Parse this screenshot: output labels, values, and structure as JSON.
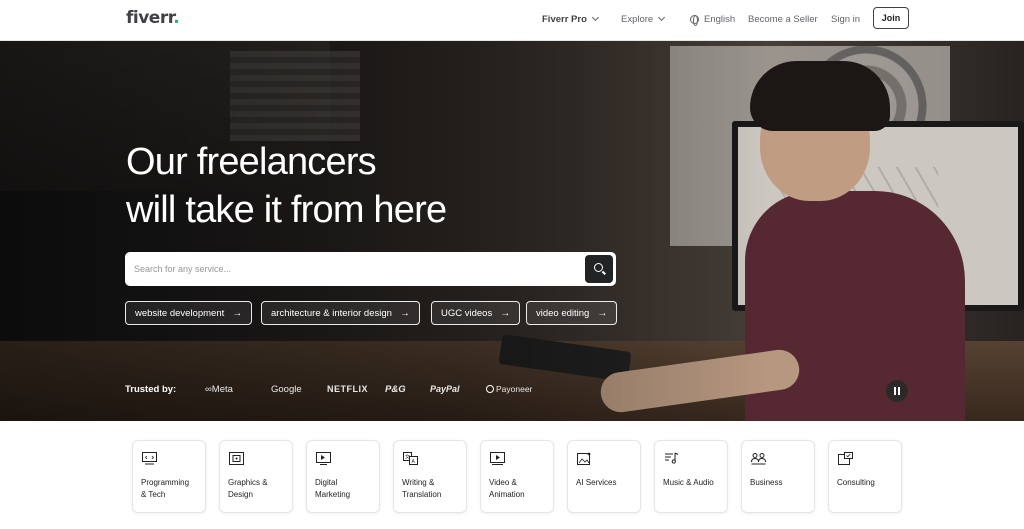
{
  "header": {
    "logo": "fiverr",
    "logo_dot": ".",
    "nav": {
      "pro": "Fiverr Pro",
      "explore": "Explore",
      "language": "English",
      "become_seller": "Become a Seller",
      "sign_in": "Sign in",
      "join": "Join"
    }
  },
  "hero": {
    "headline_line1": "Our freelancers",
    "headline_line2": "will take it from here",
    "search": {
      "placeholder": "Search for any service...",
      "button_icon": "search-icon"
    },
    "chips": [
      {
        "label": "website development",
        "icon": "arrow-right-icon"
      },
      {
        "label": "architecture & interior design",
        "icon": "arrow-right-icon"
      },
      {
        "label": "UGC videos",
        "icon": "arrow-right-icon"
      },
      {
        "label": "video editing",
        "icon": "arrow-right-icon"
      }
    ],
    "trusted_by": {
      "label": "Trusted by:",
      "brands": [
        "Meta",
        "Google",
        "NETFLIX",
        "P&G",
        "PayPal",
        "Payoneer"
      ]
    },
    "video_control": "pause-icon"
  },
  "categories": [
    {
      "label_line1": "Programming",
      "label_line2": "& Tech",
      "icon": "monitor-code-icon"
    },
    {
      "label_line1": "Graphics &",
      "label_line2": "Design",
      "icon": "design-frame-icon"
    },
    {
      "label_line1": "Digital",
      "label_line2": "Marketing",
      "icon": "marketing-screen-icon"
    },
    {
      "label_line1": "Writing &",
      "label_line2": "Translation",
      "icon": "translation-icon"
    },
    {
      "label_line1": "Video &",
      "label_line2": "Animation",
      "icon": "video-play-icon"
    },
    {
      "label_line1": "AI Services",
      "label_line2": "",
      "icon": "ai-image-icon"
    },
    {
      "label_line1": "Music & Audio",
      "label_line2": "",
      "icon": "music-note-icon"
    },
    {
      "label_line1": "Business",
      "label_line2": "",
      "icon": "business-people-icon"
    },
    {
      "label_line1": "Consulting",
      "label_line2": "",
      "icon": "consulting-chat-icon"
    }
  ],
  "colors": {
    "brand_green": "#1dbf73",
    "text_dark": "#222325",
    "text_muted": "#62646a"
  }
}
